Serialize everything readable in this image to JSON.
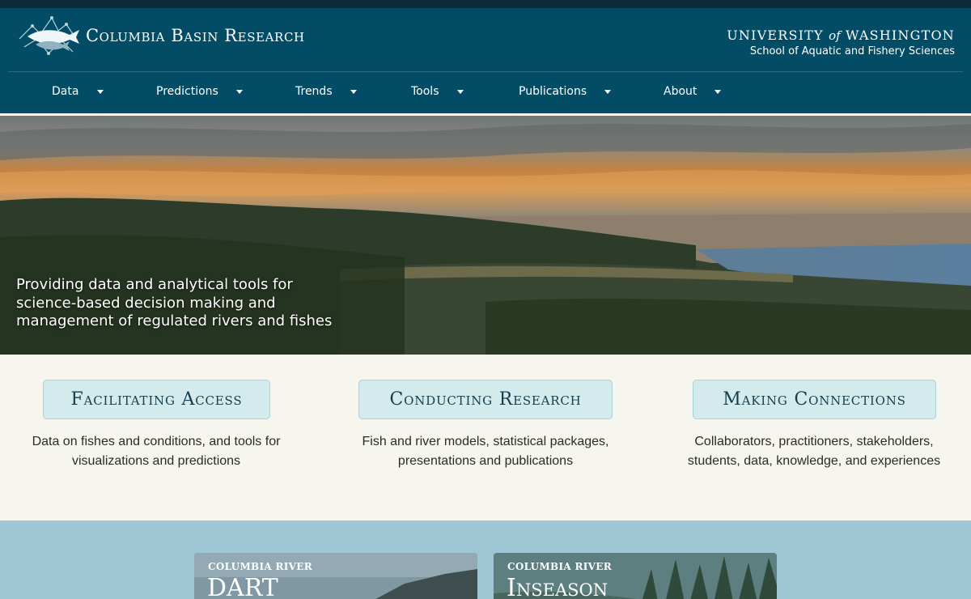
{
  "header": {
    "site_title": "Columbia Basin Research",
    "university_pre": "UNIVERSITY",
    "university_of": "of",
    "university_post": "WASHINGTON",
    "school": "School of Aquatic and Fishery Sciences",
    "logo_icon": "salmon-logo-icon",
    "colors": {
      "header_bg": "#034c66",
      "top_strip": "#0d2b3a"
    }
  },
  "nav": {
    "items": [
      {
        "label": "Data"
      },
      {
        "label": "Predictions"
      },
      {
        "label": "Trends"
      },
      {
        "label": "Tools"
      },
      {
        "label": "Publications"
      },
      {
        "label": "About"
      }
    ]
  },
  "hero": {
    "tagline": "Providing data and analytical tools for science-based decision making and management of regulated rivers and fishes"
  },
  "features": [
    {
      "title": "Facilitating Access",
      "description": "Data on fishes and conditions, and tools for visualizations and predictions"
    },
    {
      "title": "Conducting Research",
      "description": "Fish and river models, statistical packages, presentations and publications"
    },
    {
      "title": "Making Connections",
      "description": "Collaborators, practitioners, stakeholders, students, data, knowledge, and experiences"
    }
  ],
  "cards": [
    {
      "kicker": "COLUMBIA RIVER",
      "title": "DART"
    },
    {
      "kicker": "COLUMBIA RIVER",
      "title": "Inseason"
    }
  ]
}
